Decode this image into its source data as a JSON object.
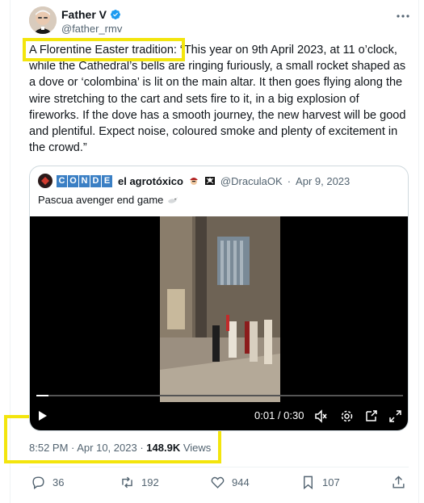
{
  "author": {
    "name": "Father V",
    "handle": "@father_rmv"
  },
  "tweet": {
    "highlight": "A Florentine Easter tradition:",
    "text": " “This year on 9th April 2023, at 11 o’clock, while the Cathedral’s bells are ringing furiously, a small rocket shaped as a dove or ‘colombina’ is lit on the main altar. It then goes flying along the wire stretching to the cart and sets fire to it, in a big explosion of fireworks. If the dove has a smooth journey, the new harvest will be good and plentiful. Expect noise, coloured smoke and plenty of excitement in the crowd.”"
  },
  "quote": {
    "badge_letters": [
      "C",
      "O",
      "N",
      "D",
      "E"
    ],
    "name": "el agrotóxico",
    "handle": "@DraculaOK",
    "date": "Apr 9, 2023",
    "text": "Pascua avenger end game",
    "video": {
      "time": "0:01 / 0:30",
      "progress": 0.033
    }
  },
  "meta": {
    "timestamp": "8:52 PM · Apr 10, 2023",
    "views_count": "148.9K",
    "views_label": "Views"
  },
  "actions": {
    "replies": "36",
    "reposts": "192",
    "likes": "944",
    "bookmarks": "107"
  },
  "colors": {
    "highlight": "#f3e50d",
    "verified": "#1d9bf0",
    "muted": "#536471"
  }
}
